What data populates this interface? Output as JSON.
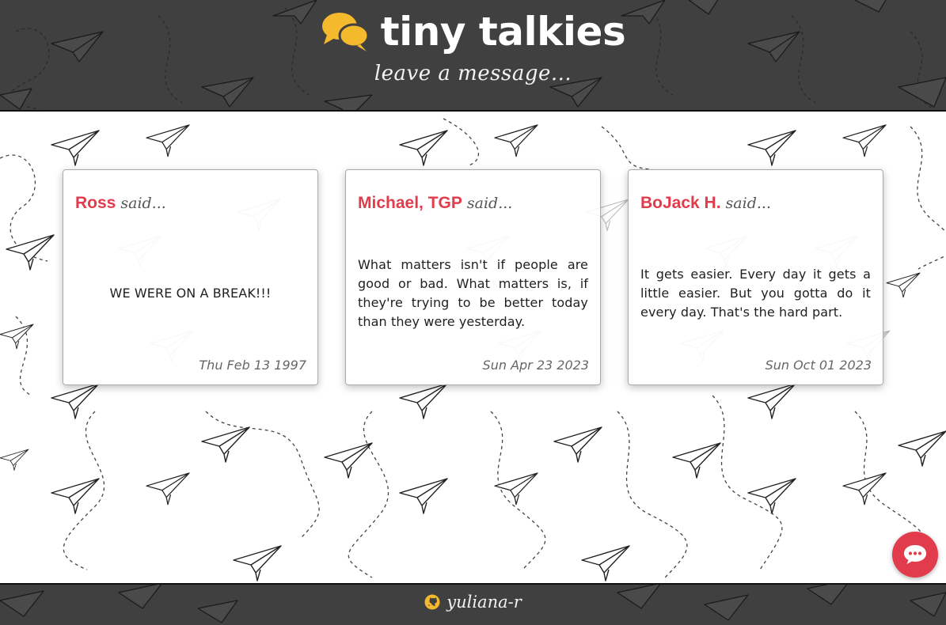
{
  "header": {
    "title": "tiny talkies",
    "subtitle": "leave a message..."
  },
  "messages": [
    {
      "name": "Ross",
      "said": "said...",
      "text": "WE WERE ON A BREAK!!!",
      "date": "Thu Feb 13 1997"
    },
    {
      "name": "Michael, TGP",
      "said": "said...",
      "text": "What matters isn't if people are good or bad. What matters is, if they're trying to be better today than they were yesterday.",
      "date": "Sun Apr 23 2023"
    },
    {
      "name": "BoJack H.",
      "said": "said...",
      "text": "It gets easier. Every day it gets a little easier. But you gotta do it every day. That's the hard part.",
      "date": "Sun Oct 01 2023"
    }
  ],
  "footer": {
    "link_text": "yuliana-r"
  },
  "icons": {
    "logo": "speech-bubbles-icon",
    "footer": "github-icon",
    "fab": "chat-dots-icon"
  },
  "colors": {
    "header_bg": "#404040",
    "accent": "#e23b4b",
    "logo": "#f5b92e",
    "page_bg": "#ffffff"
  }
}
